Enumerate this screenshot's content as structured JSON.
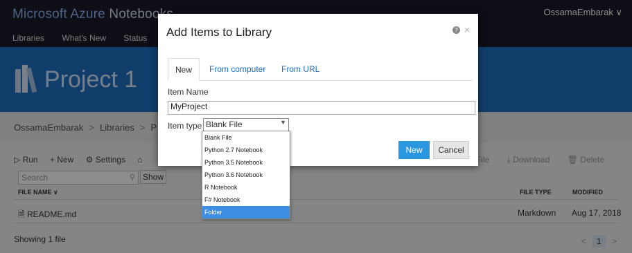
{
  "app": {
    "brand_prefix": "Microsoft Azure",
    "brand_suffix": "Notebooks",
    "user": "OssamaEmbarak ∨"
  },
  "nav": [
    "Libraries",
    "What's New",
    "Status"
  ],
  "project": {
    "title": "Project 1"
  },
  "breadcrumb": [
    "OssamaEmbarak",
    "Libraries",
    "P"
  ],
  "toolbar": {
    "run": "▷ Run",
    "new": "+ New",
    "settings": "⚙ Settings",
    "share": "⌂"
  },
  "toolbar_right": {
    "edit": "it File",
    "download": "⤓ Download",
    "delete": "🗑 Delete"
  },
  "search": {
    "placeholder": "Search",
    "show_hidden": "Show hidden items"
  },
  "table": {
    "headers": {
      "name": "FILE NAME ∨",
      "type": "FILE TYPE",
      "modified": "MODIFIED"
    },
    "rows": [
      {
        "name": "README.md",
        "type": "Markdown",
        "modified": "Aug 17, 2018"
      }
    ]
  },
  "footer": {
    "status": "Showing 1 file"
  },
  "pager": {
    "prev": "<",
    "page": "1",
    "next": ">"
  },
  "dialog": {
    "title": "Add Items to Library",
    "tabs": [
      "New",
      "From computer",
      "From URL"
    ],
    "item_name_label": "Item Name",
    "item_name_value": "MyProject",
    "item_type_label": "Item type",
    "item_type_value": "Blank File",
    "options": [
      "Blank File",
      "Python 2.7 Notebook",
      "Python 3.5 Notebook",
      "Python 3.6 Notebook",
      "R Notebook",
      "F# Notebook",
      "Folder"
    ],
    "selected_option": "Folder",
    "new_button": "New",
    "cancel_button": "Cancel"
  },
  "colors": {
    "topbar": "#1b1b2a",
    "hero": "#1f6fc1",
    "accent": "#2a98e0",
    "selection": "#3d8ee3"
  }
}
